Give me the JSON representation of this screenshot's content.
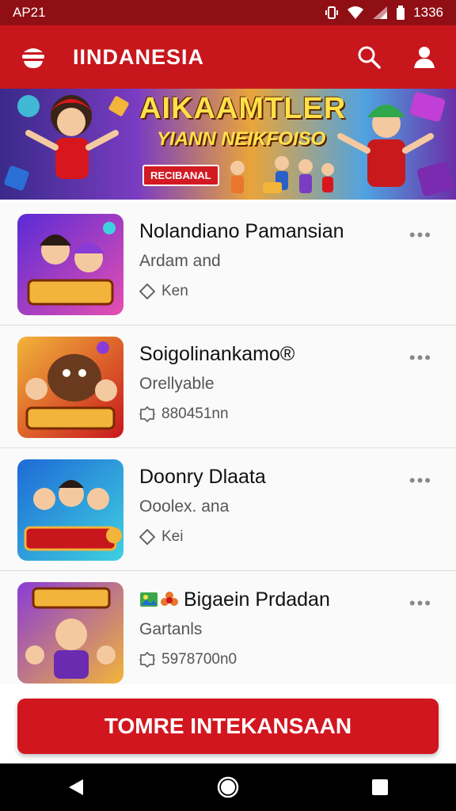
{
  "status": {
    "time": "AP21",
    "battery": "1336"
  },
  "appbar": {
    "title": "IINDANESIA",
    "menu_icon": "menu-icon",
    "search_icon": "search-icon",
    "profile_icon": "profile-icon"
  },
  "banner": {
    "title": "AIKAAMTLER",
    "subtitle": "YIANN NEIKFOISO",
    "badge": "RECIBANAL"
  },
  "list": {
    "items": [
      {
        "title": "Nolandiano Pamansian",
        "subtitle": "Ardam and",
        "meta": "Ken",
        "meta_icon": "tag-icon"
      },
      {
        "title": "Soigolinankamo®",
        "subtitle": "Orellyable",
        "meta": "880451nn",
        "meta_icon": "gear-icon"
      },
      {
        "title": "Doonry Dlaata",
        "subtitle": "Ooolex. ana",
        "meta": "Kei",
        "meta_icon": "tag-icon"
      },
      {
        "title": "Bigaein Prdadan",
        "subtitle": "Gartanls",
        "meta": "5978700n0",
        "meta_icon": "gear-icon"
      }
    ],
    "more_label": "•••"
  },
  "cta": {
    "label": "TOMRE INTEKANSAAN"
  },
  "colors": {
    "brand": "#c8161d",
    "status": "#8f0f14",
    "cta": "#d2161f"
  }
}
